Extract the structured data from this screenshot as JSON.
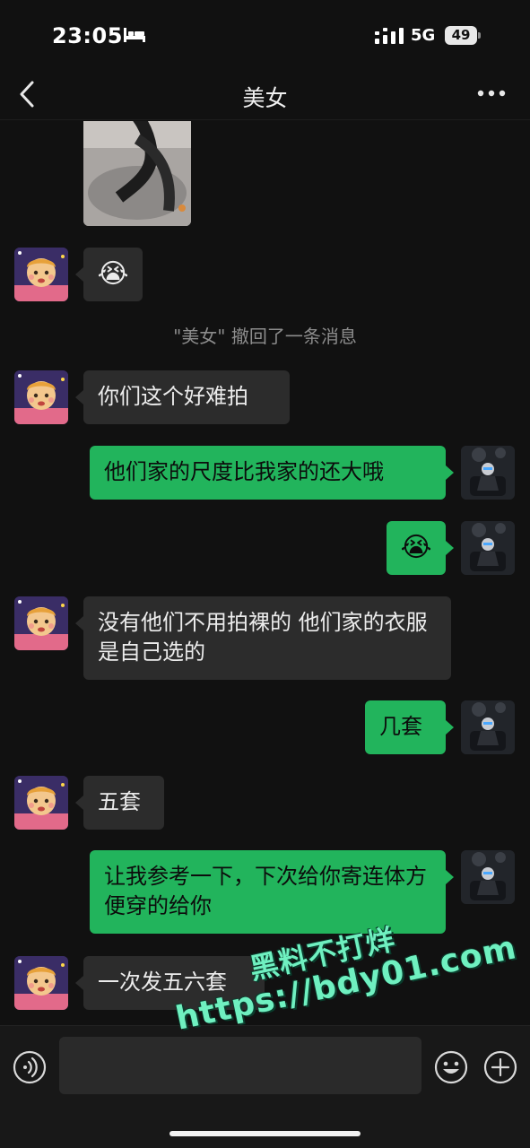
{
  "status_bar": {
    "time": "23:05",
    "network": "5G",
    "battery": "49"
  },
  "nav": {
    "title": "美女"
  },
  "messages": [
    {
      "from": "other",
      "type": "image"
    },
    {
      "from": "other",
      "type": "emoji",
      "emoji": "😭"
    },
    {
      "from": "system",
      "type": "notice",
      "text": "\"美女\" 撤回了一条消息"
    },
    {
      "from": "other",
      "type": "text",
      "text": "你们这个好难拍"
    },
    {
      "from": "self",
      "type": "text",
      "text": "他们家的尺度比我家的还大哦"
    },
    {
      "from": "self",
      "type": "emoji",
      "emoji": "😭"
    },
    {
      "from": "other",
      "type": "text",
      "text": "没有他们不用拍裸的 他们家的衣服是自己选的"
    },
    {
      "from": "self",
      "type": "text",
      "text": "几套"
    },
    {
      "from": "other",
      "type": "text",
      "text": "五套"
    },
    {
      "from": "self",
      "type": "text",
      "text": "让我参考一下，下次给你寄连体方便穿的给你"
    },
    {
      "from": "other",
      "type": "text",
      "text": "一次发五六套"
    }
  ],
  "input_bar": {
    "placeholder": "",
    "value": ""
  },
  "watermark": {
    "line1": "黑料不打烊",
    "line2": "https://bdy01.com"
  },
  "icons": {
    "back": "chevron-left-icon",
    "more": "more-dots-icon",
    "voice": "voice-icon",
    "emoji": "smiley-icon",
    "add": "plus-icon",
    "signal": "signal-icon",
    "sleep": "bed-icon"
  },
  "colors": {
    "background": "#111111",
    "bubble_other": "#2c2c2c",
    "bubble_self": "#22b45c",
    "system_text": "#8c8c8c",
    "watermark": "#6ff0c0"
  }
}
